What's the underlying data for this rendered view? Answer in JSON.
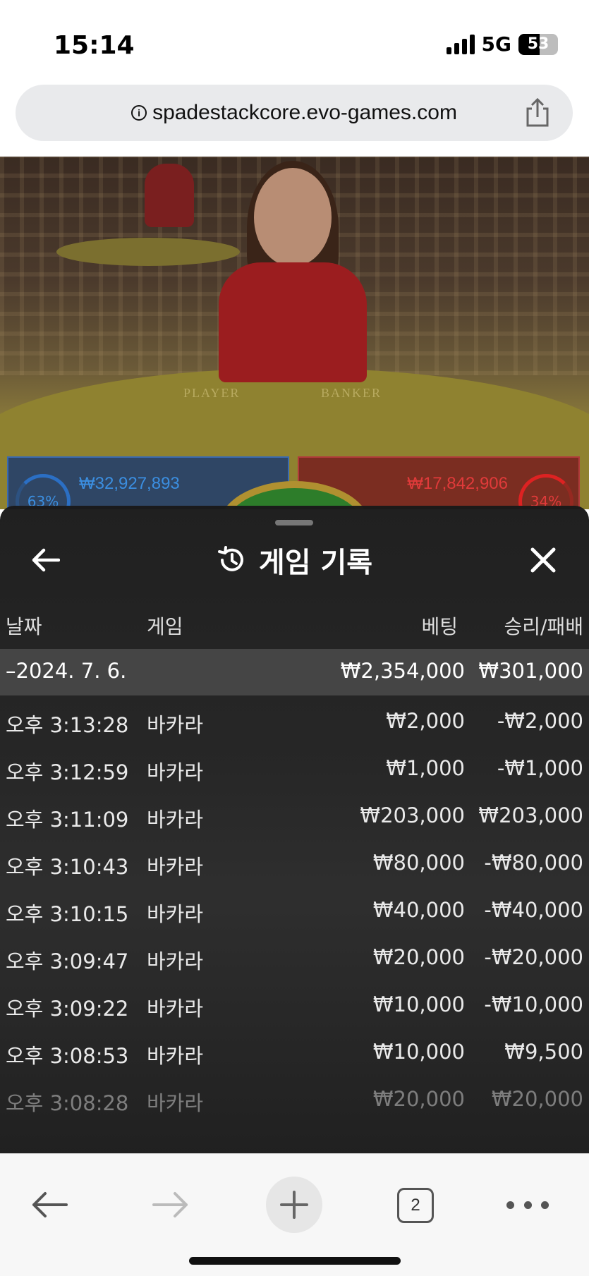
{
  "status_bar": {
    "time": "15:14",
    "network": "5G",
    "battery": "53"
  },
  "browser": {
    "url": "spadestackcore.evo-games.com"
  },
  "video": {
    "player_label": "PLAYER",
    "banker_label": "BANKER",
    "player_percent": "63%",
    "player_amount": "₩32,927,893",
    "banker_percent": "34%",
    "banker_amount": "₩17,842,906"
  },
  "history": {
    "title": "게임 기록",
    "columns": {
      "date": "날짜",
      "game": "게임",
      "bet": "베팅",
      "result": "승리/패배"
    },
    "date_group": {
      "date": "–2024. 7. 6.",
      "bet_total": "₩2,354,000",
      "result_total": "₩301,000"
    },
    "rows": [
      {
        "time": "오후 3:13:28",
        "game": "바카라",
        "bet": "₩2,000",
        "result": "-₩2,000"
      },
      {
        "time": "오후 3:12:59",
        "game": "바카라",
        "bet": "₩1,000",
        "result": "-₩1,000"
      },
      {
        "time": "오후 3:11:09",
        "game": "바카라",
        "bet": "₩203,000",
        "result": "₩203,000"
      },
      {
        "time": "오후 3:10:43",
        "game": "바카라",
        "bet": "₩80,000",
        "result": "-₩80,000"
      },
      {
        "time": "오후 3:10:15",
        "game": "바카라",
        "bet": "₩40,000",
        "result": "-₩40,000"
      },
      {
        "time": "오후 3:09:47",
        "game": "바카라",
        "bet": "₩20,000",
        "result": "-₩20,000"
      },
      {
        "time": "오후 3:09:22",
        "game": "바카라",
        "bet": "₩10,000",
        "result": "-₩10,000"
      },
      {
        "time": "오후 3:08:53",
        "game": "바카라",
        "bet": "₩10,000",
        "result": "₩9,500"
      },
      {
        "time": "오후 3:08:28",
        "game": "바카라",
        "bet": "₩20,000",
        "result": "₩20,000"
      }
    ]
  },
  "toolbar": {
    "tab_count": "2"
  },
  "colors": {
    "player": "#3b8ee0",
    "banker": "#e03a3a",
    "sheet_bg": "#1e1e1e",
    "date_row_bg": "#454545"
  }
}
